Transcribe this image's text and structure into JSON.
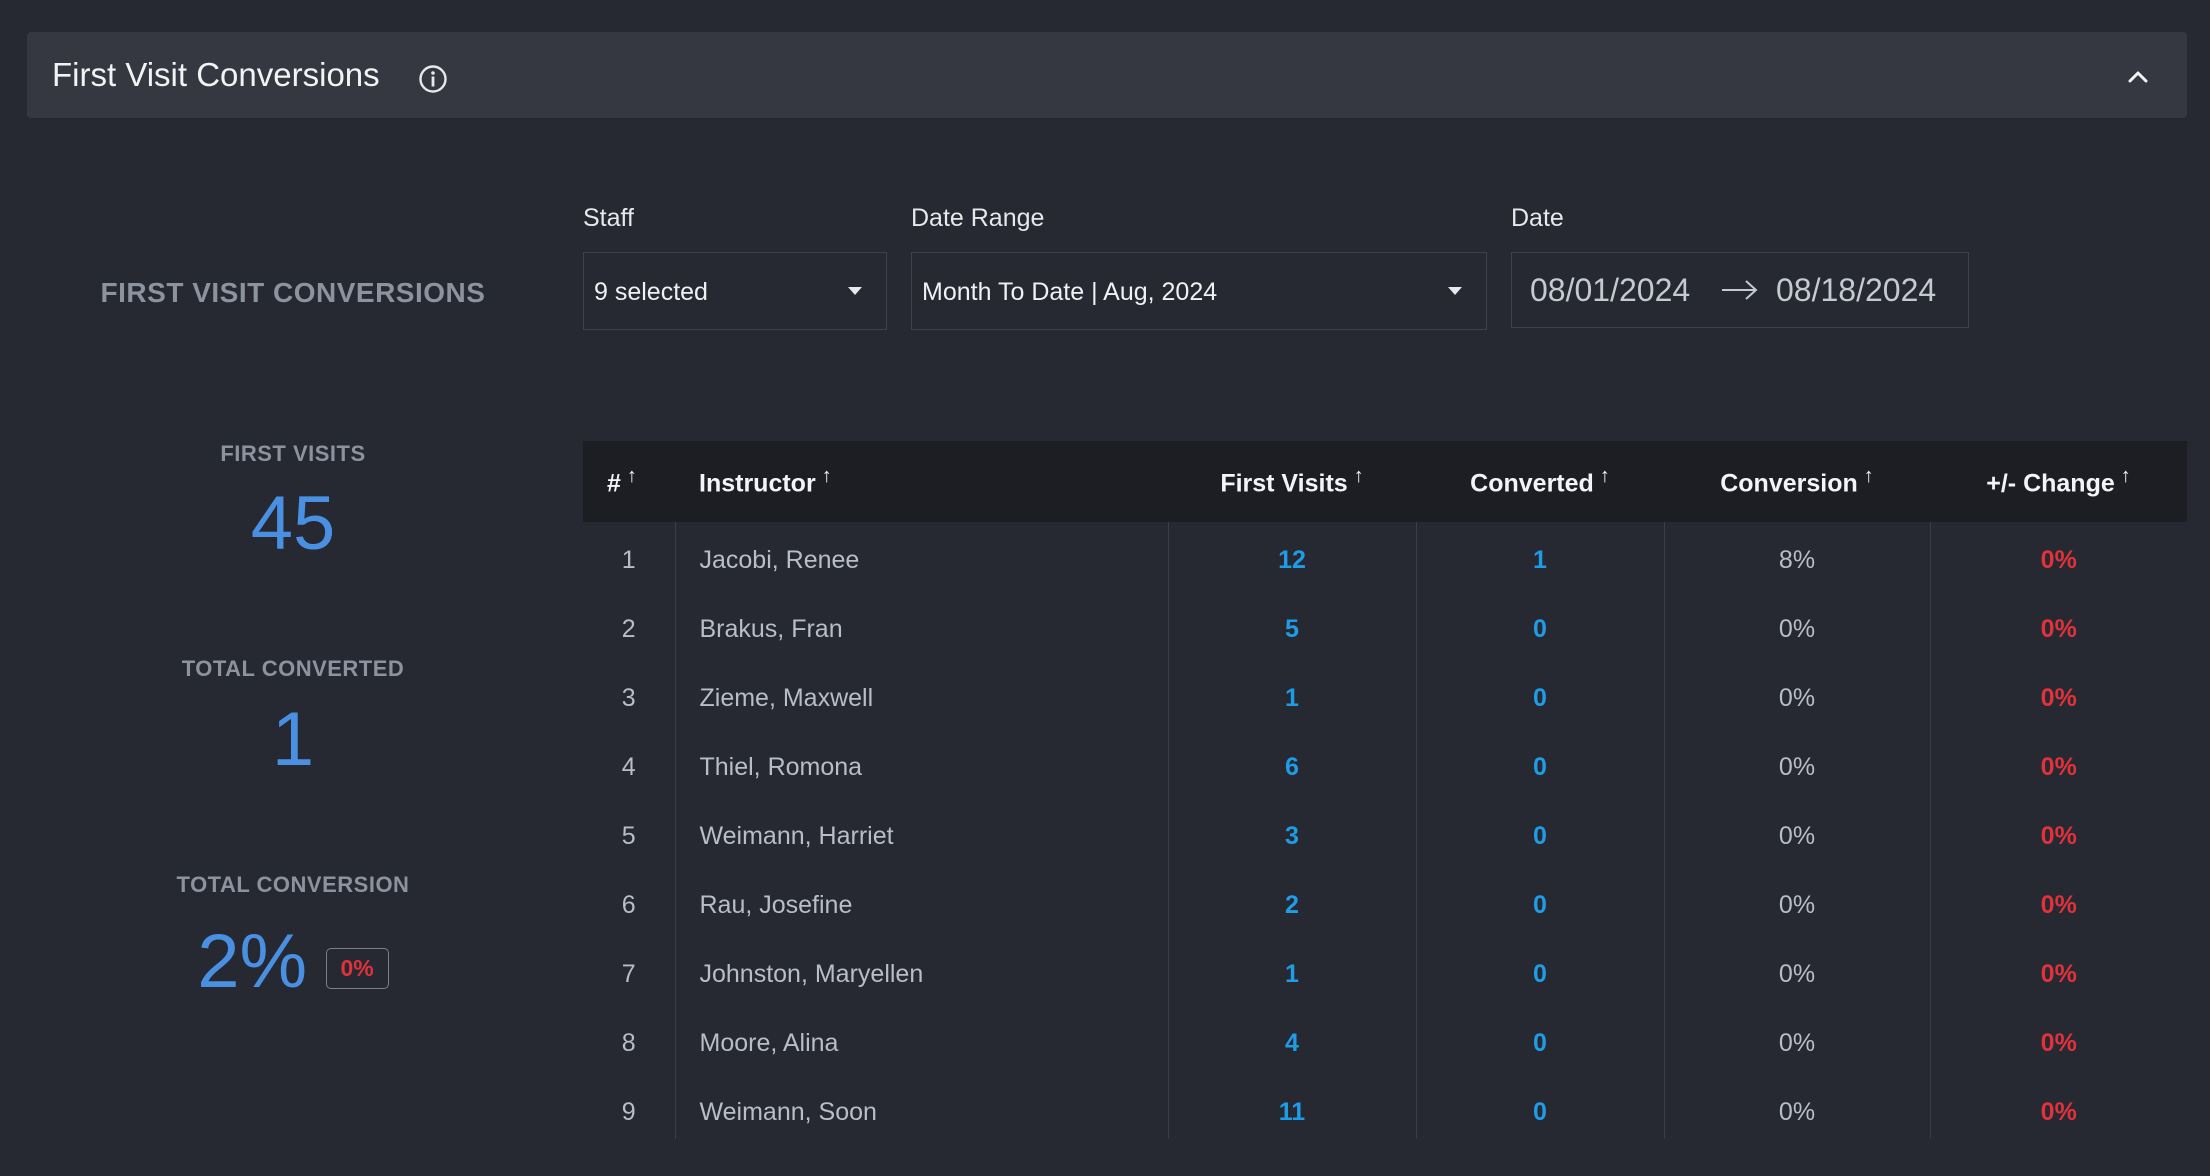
{
  "header": {
    "title": "First Visit Conversions"
  },
  "section_label": "FIRST VISIT CONVERSIONS",
  "filters": {
    "staff": {
      "label": "Staff",
      "value": "9 selected"
    },
    "date_range": {
      "label": "Date Range",
      "value": "Month To Date | Aug, 2024"
    },
    "date": {
      "label": "Date",
      "start": "08/01/2024",
      "end": "08/18/2024"
    }
  },
  "stats": {
    "first_visits": {
      "label": "FIRST VISITS",
      "value": "45"
    },
    "total_converted": {
      "label": "TOTAL CONVERTED",
      "value": "1"
    },
    "total_conversion": {
      "label": "TOTAL CONVERSION",
      "value": "2%",
      "change": "0%"
    }
  },
  "table": {
    "columns": [
      "#",
      "Instructor",
      "First Visits",
      "Converted",
      "Conversion",
      "+/- Change"
    ],
    "rows": [
      [
        "1",
        "Jacobi, Renee",
        "12",
        "1",
        "8%",
        "0%"
      ],
      [
        "2",
        "Brakus, Fran",
        "5",
        "0",
        "0%",
        "0%"
      ],
      [
        "3",
        "Zieme, Maxwell",
        "1",
        "0",
        "0%",
        "0%"
      ],
      [
        "4",
        "Thiel, Romona",
        "6",
        "0",
        "0%",
        "0%"
      ],
      [
        "5",
        "Weimann, Harriet",
        "3",
        "0",
        "0%",
        "0%"
      ],
      [
        "6",
        "Rau, Josefine",
        "2",
        "0",
        "0%",
        "0%"
      ],
      [
        "7",
        "Johnston, Maryellen",
        "1",
        "0",
        "0%",
        "0%"
      ],
      [
        "8",
        "Moore, Alina",
        "4",
        "0",
        "0%",
        "0%"
      ],
      [
        "9",
        "Weimann, Soon",
        "11",
        "0",
        "0%",
        "0%"
      ]
    ]
  },
  "colors": {
    "background": "#262832",
    "header_bar": "#353841",
    "stat_blue": "#4a90e2",
    "link_blue": "#1e9de6",
    "change_red": "#e0323b"
  },
  "icons": {
    "info": "info-icon",
    "collapse": "chevron-up-icon",
    "sort": "sort-arrow-up-icon",
    "dropdown": "caret-down-icon",
    "date_separator": "arrow-right-icon"
  }
}
